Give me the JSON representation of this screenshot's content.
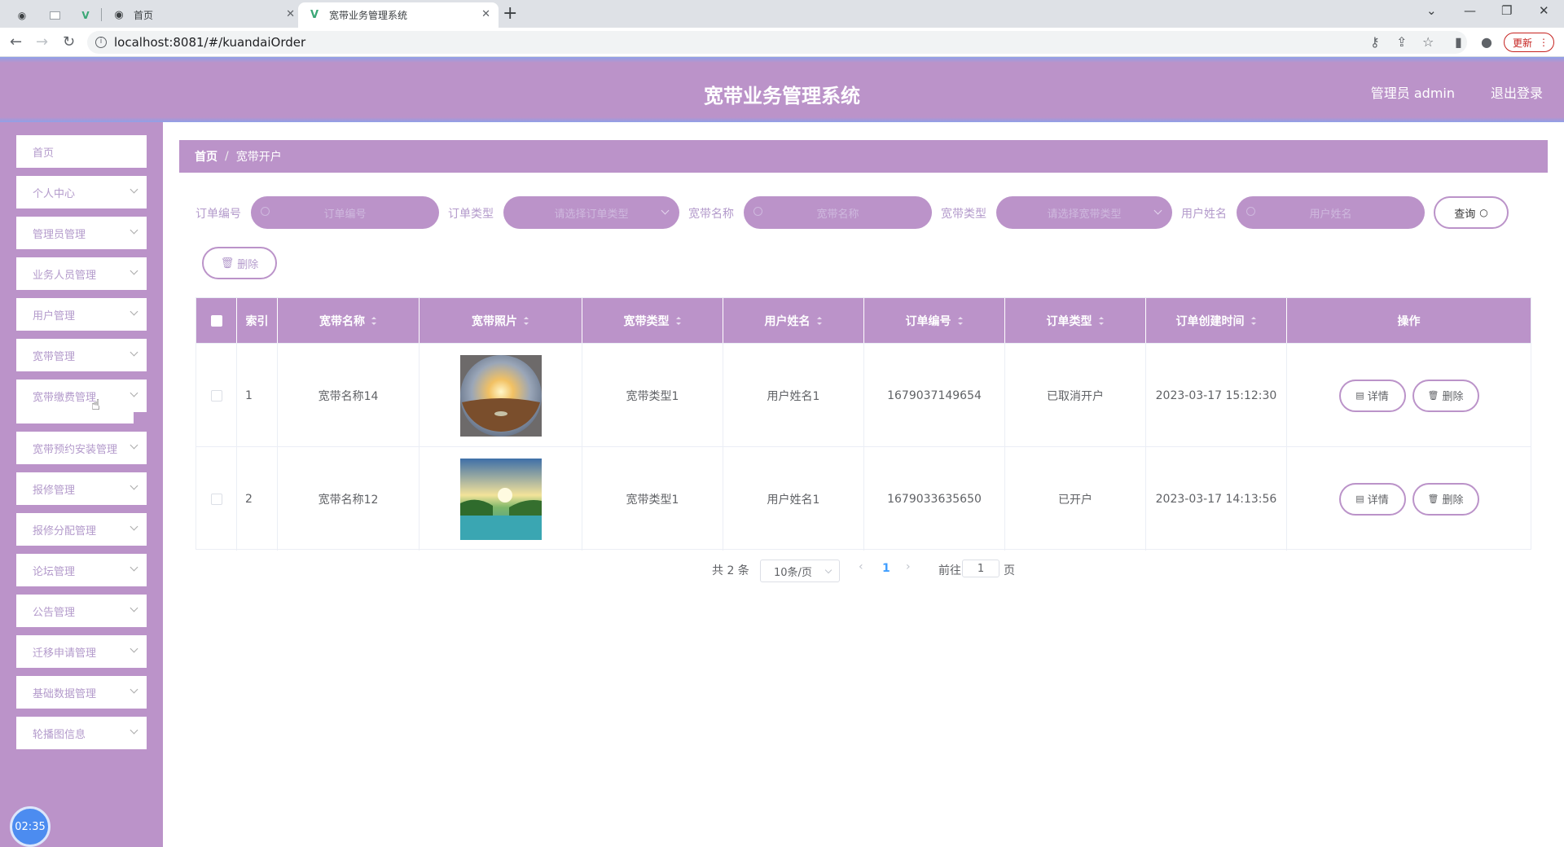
{
  "browser": {
    "tabs": [
      {
        "label": "首页",
        "icon": "globe-icon"
      },
      {
        "label": "宽带业务管理系统",
        "icon": "vue-logo-icon"
      }
    ],
    "url": "localhost:8081/#/kuandaiOrder",
    "update_label": "更新"
  },
  "header": {
    "title": "宽带业务管理系统",
    "user_label": "管理员 admin",
    "logout_label": "退出登录"
  },
  "sidebar": {
    "items": [
      {
        "label": "首页"
      },
      {
        "label": "个人中心"
      },
      {
        "label": "管理员管理"
      },
      {
        "label": "业务人员管理"
      },
      {
        "label": "用户管理"
      },
      {
        "label": "宽带管理"
      },
      {
        "label": "宽带缴费管理"
      },
      {
        "label": "宽带预约安装管理"
      },
      {
        "label": "报修管理"
      },
      {
        "label": "报修分配管理"
      },
      {
        "label": "论坛管理"
      },
      {
        "label": "公告管理"
      },
      {
        "label": "迁移申请管理"
      },
      {
        "label": "基础数据管理"
      },
      {
        "label": "轮播图信息"
      }
    ],
    "clock": "02:35"
  },
  "breadcrumb": {
    "home": "首页",
    "separator": "/",
    "current": "宽带开户"
  },
  "filters": {
    "order_no_label": "订单编号",
    "order_no_placeholder": "订单编号",
    "order_type_label": "订单类型",
    "order_type_placeholder": "请选择订单类型",
    "bb_name_label": "宽带名称",
    "bb_name_placeholder": "宽带名称",
    "bb_type_label": "宽带类型",
    "bb_type_placeholder": "请选择宽带类型",
    "user_name_label": "用户姓名",
    "user_name_placeholder": "用户姓名",
    "query_label": "查询",
    "delete_label": "删除"
  },
  "table": {
    "headers": [
      "索引",
      "宽带名称",
      "宽带照片",
      "宽带类型",
      "用户姓名",
      "订单编号",
      "订单类型",
      "订单创建时间",
      "操作"
    ],
    "rows": [
      {
        "index": "1",
        "name": "宽带名称14",
        "photo": "sunset-desert-image",
        "type": "宽带类型1",
        "user": "用户姓名1",
        "order_no": "1679037149654",
        "order_type": "已取消开户",
        "created": "2023-03-17 15:12:30"
      },
      {
        "index": "2",
        "name": "宽带名称12",
        "photo": "lake-sunrise-image",
        "type": "宽带类型1",
        "user": "用户姓名1",
        "order_no": "1679033635650",
        "order_type": "已开户",
        "created": "2023-03-17 14:13:56"
      }
    ],
    "detail_label": "详情",
    "delete_label": "删除"
  },
  "pagination": {
    "total": "共 2 条",
    "page_size": "10条/页",
    "current_page": "1",
    "goto_label": "前往",
    "goto_value": "1",
    "page_suffix": "页"
  },
  "colors": {
    "accent": "#bb93c9",
    "header_edge": "#8fa0e8"
  }
}
